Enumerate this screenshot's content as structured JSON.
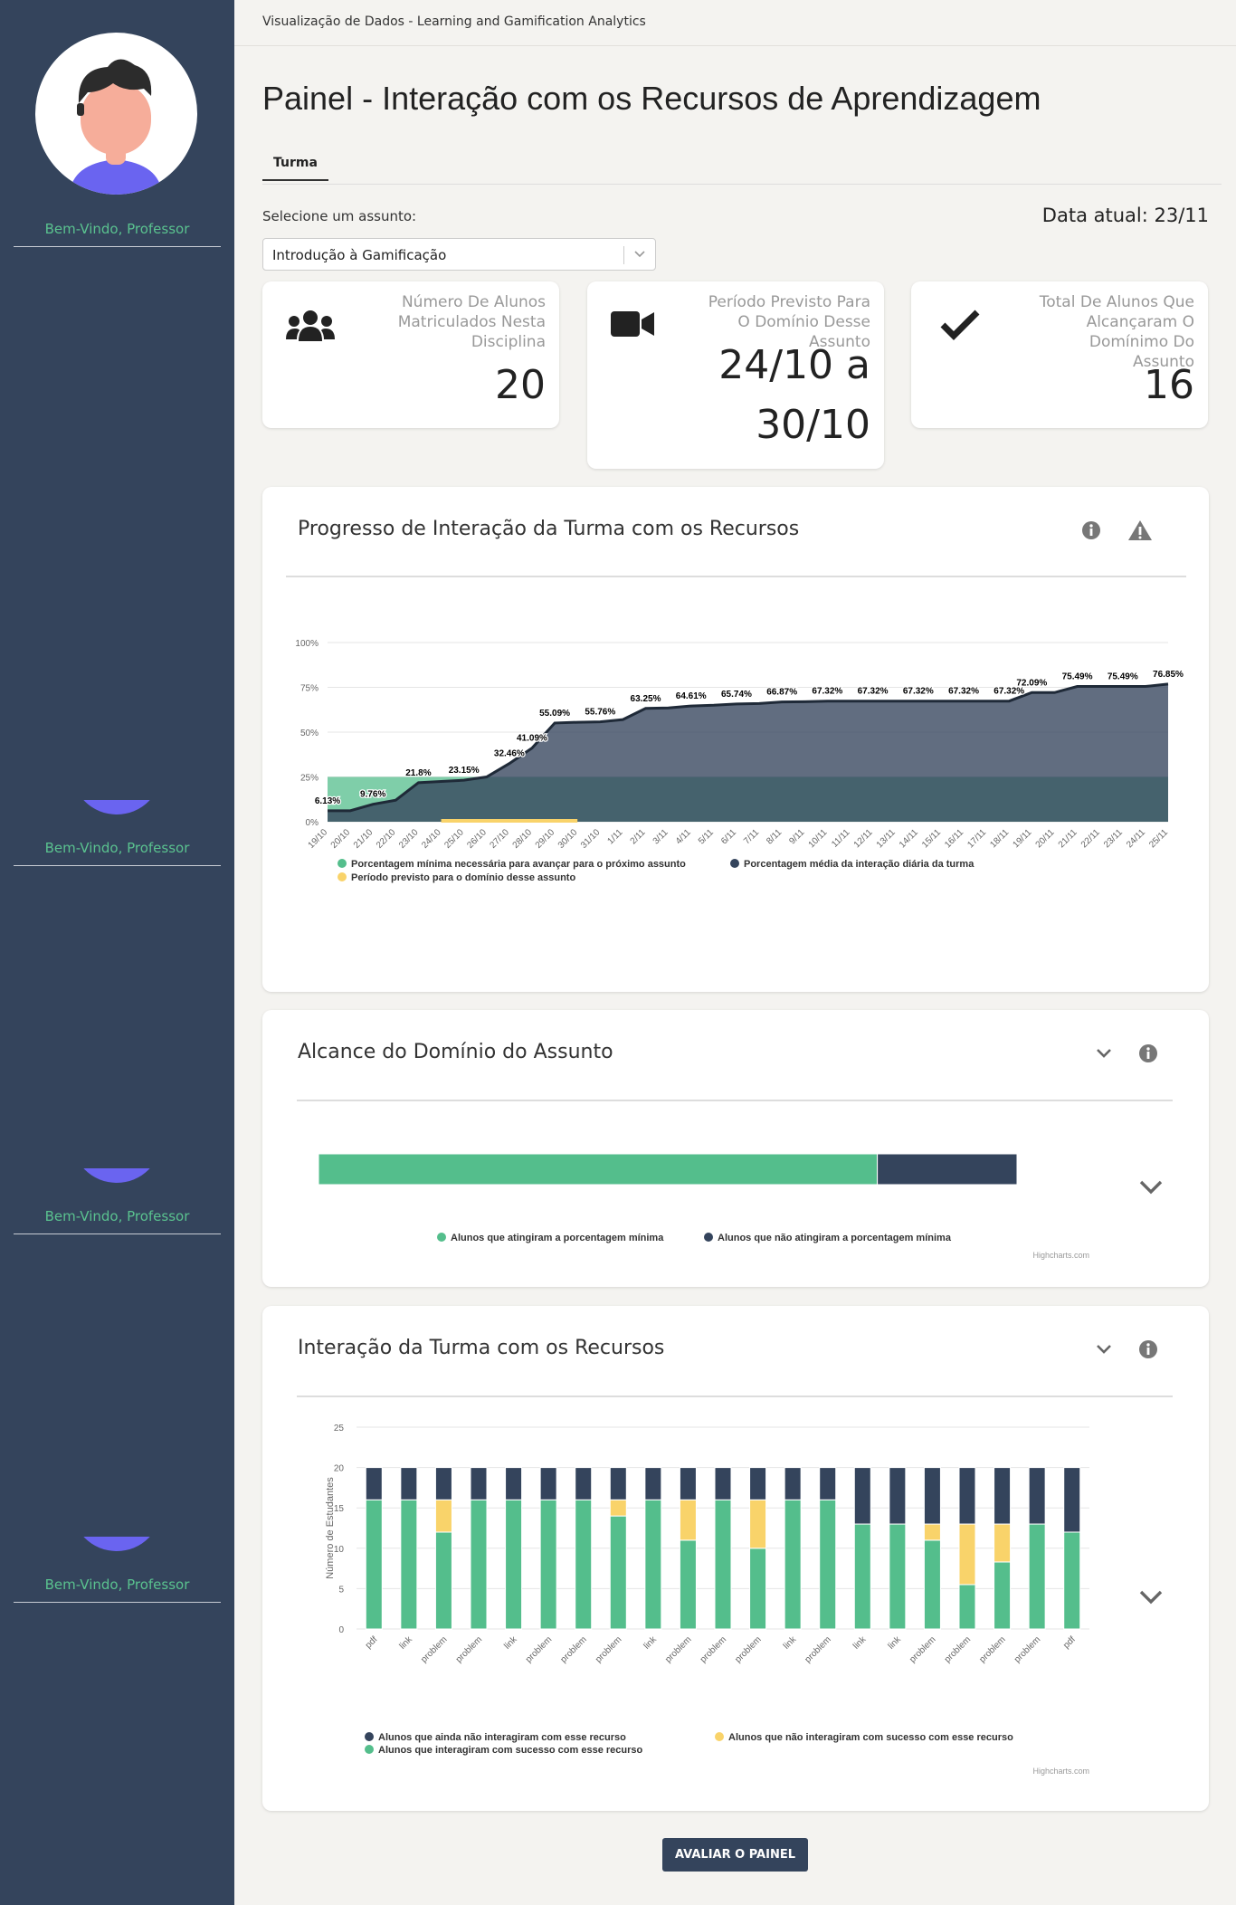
{
  "sidebar": {
    "welcome": "Bem-Vindo, Professor",
    "avatar": "user-avatar"
  },
  "header": {
    "app_title": "Visualização de Dados - Learning and Gamification Analytics",
    "page_title": "Painel - Interação com os Recursos de Aprendizagem"
  },
  "tabs": [
    {
      "label": "Turma"
    }
  ],
  "subject": {
    "label": "Selecione um assunto:",
    "value": "Introdução à Gamificação",
    "date_label": "Data atual: 23/11"
  },
  "kpis": [
    {
      "icon": "users-icon",
      "label": "Número De Alunos Matriculados Nesta Disciplina",
      "value": "20"
    },
    {
      "icon": "video-camera-icon",
      "label": "Período Previsto Para O Domínio Desse Assunto",
      "value_line1": "24/10 a",
      "value_line2": "30/10"
    },
    {
      "icon": "check-icon",
      "label": "Total De Alunos Que Alcançaram O Domínimo Do Assunto",
      "value": "16"
    }
  ],
  "panels": {
    "progress": {
      "title": "Progresso de Interação da Turma com os Recursos",
      "icons": [
        "info-icon",
        "warning-icon"
      ]
    },
    "mastery": {
      "title": "Alcance do Domínio do Assunto",
      "icons": [
        "chevron-down-icon",
        "info-icon"
      ]
    },
    "resources": {
      "title": "Interação da Turma com os Recursos",
      "icons": [
        "chevron-down-icon",
        "info-icon"
      ]
    }
  },
  "credits": "Highcharts.com",
  "button_label": "AVALIAR O PAINEL",
  "colors": {
    "green": "#54be8c",
    "navy": "#34445c",
    "yellow": "#f9d36a",
    "sidebar": "#34445c"
  },
  "chart_data": [
    {
      "type": "area",
      "title": "",
      "ylim": [
        0,
        100
      ],
      "yticks": [
        "0%",
        "25%",
        "50%",
        "75%",
        "100%"
      ],
      "categories": [
        "19/10",
        "20/10",
        "21/10",
        "22/10",
        "23/10",
        "24/10",
        "25/10",
        "26/10",
        "27/10",
        "28/10",
        "29/10",
        "30/10",
        "31/10",
        "1/11",
        "2/11",
        "3/11",
        "4/11",
        "5/11",
        "6/11",
        "7/11",
        "8/11",
        "9/11",
        "10/11",
        "11/11",
        "12/11",
        "13/11",
        "14/11",
        "15/11",
        "16/11",
        "17/11",
        "18/11",
        "19/11",
        "20/11",
        "21/11",
        "22/11",
        "23/11",
        "24/11",
        "25/11"
      ],
      "series": [
        {
          "name": "Porcentagem média da interação diária da turma",
          "color": "#34445c",
          "values": [
            6.13,
            6.13,
            9.76,
            12,
            21.8,
            22.5,
            23.15,
            25,
            32.46,
            41.09,
            55.09,
            55.5,
            55.76,
            57,
            63.25,
            63.5,
            64.61,
            65,
            65.74,
            66,
            66.87,
            67,
            67.32,
            67.32,
            67.32,
            67.32,
            67.32,
            67.32,
            67.32,
            67.32,
            67.32,
            72.09,
            72.09,
            75.49,
            75.49,
            75.49,
            75.49,
            76.85
          ]
        },
        {
          "name": "Porcentagem mínima necessária para avançar para o próximo assunto",
          "color": "#54be8c",
          "values": [
            25
          ]
        },
        {
          "name": "Período previsto para o domínio desse assunto",
          "color": "#f9d36a",
          "range": [
            "24/10",
            "30/10"
          ]
        }
      ],
      "data_labels": [
        [
          "19/10",
          "6.13%"
        ],
        [
          "21/10",
          "9.76%"
        ],
        [
          "23/10",
          "21.8%"
        ],
        [
          "25/10",
          "23.15%"
        ],
        [
          "27/10",
          "32.46%"
        ],
        [
          "28/10",
          "41.09%"
        ],
        [
          "29/10",
          "55.09%"
        ],
        [
          "31/10",
          "55.76%"
        ],
        [
          "2/11",
          "63.25%"
        ],
        [
          "4/11",
          "64.61%"
        ],
        [
          "6/11",
          "65.74%"
        ],
        [
          "8/11",
          "66.87%"
        ],
        [
          "10/11",
          "67.32%"
        ],
        [
          "12/11",
          "67.32%"
        ],
        [
          "14/11",
          "67.32%"
        ],
        [
          "16/11",
          "67.32%"
        ],
        [
          "18/11",
          "67.32%"
        ],
        [
          "19/11",
          "72.09%"
        ],
        [
          "21/11",
          "75.49%"
        ],
        [
          "23/11",
          "75.49%"
        ],
        [
          "25/11",
          "76.85%"
        ]
      ]
    },
    {
      "type": "bar",
      "title": "",
      "series": [
        {
          "name": "Alunos que atingiram a porcentagem mínima",
          "color": "#54be8c",
          "value": 16
        },
        {
          "name": "Alunos que não atingiram a porcentagem mínima",
          "color": "#34445c",
          "value": 4
        }
      ]
    },
    {
      "type": "bar",
      "title": "",
      "ylabel": "Número de Estudantes",
      "ylim": [
        0,
        25
      ],
      "yticks": [
        "0",
        "5",
        "10",
        "15",
        "20",
        "25"
      ],
      "categories": [
        "pdf",
        "link",
        "problem",
        "problem",
        "link",
        "problem",
        "problem",
        "problem",
        "link",
        "problem",
        "problem",
        "problem",
        "link",
        "problem",
        "link",
        "link",
        "problem",
        "problem",
        "problem",
        "problem",
        "pdf"
      ],
      "series": [
        {
          "name": "Alunos que interagiram com sucesso com esse recurso",
          "color": "#54be8c",
          "values": [
            16,
            16,
            12,
            16,
            16,
            16,
            16,
            14,
            16,
            11,
            16,
            10,
            16,
            16,
            13,
            13,
            11,
            5.5,
            8.3,
            13,
            12
          ]
        },
        {
          "name": "Alunos que não interagiram com sucesso com esse recurso",
          "color": "#f9d36a",
          "values": [
            0,
            0,
            4,
            0,
            0,
            0,
            0,
            2,
            0,
            5,
            0,
            6,
            0,
            0,
            0,
            0,
            2,
            7.5,
            4.7,
            0,
            0
          ]
        },
        {
          "name": "Alunos que ainda não interagiram com esse recurso",
          "color": "#34445c",
          "values": [
            4,
            4,
            4,
            4,
            4,
            4,
            4,
            4,
            4,
            4,
            4,
            4,
            4,
            4,
            7,
            7,
            7,
            7,
            7,
            7,
            8
          ]
        }
      ]
    }
  ]
}
